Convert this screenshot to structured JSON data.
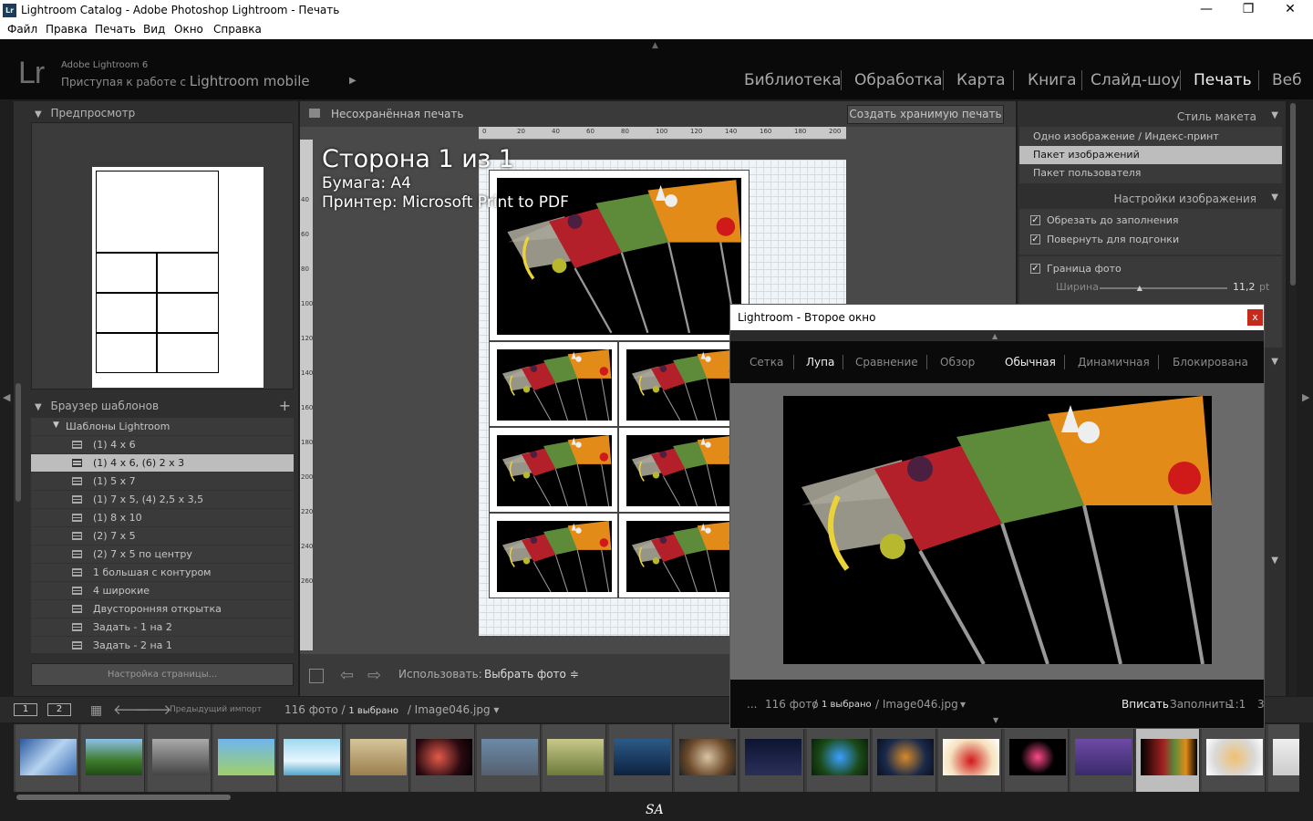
{
  "window": {
    "title": "Lightroom Catalog - Adobe Photoshop Lightroom - Печать",
    "app_badge": "Lr",
    "minimize": "—",
    "maximize": "❐",
    "close": "✕"
  },
  "menu": [
    "Файл",
    "Правка",
    "Печать",
    "Вид",
    "Окно",
    "Справка"
  ],
  "identity": {
    "logo": "Lr",
    "product": "Adobe Lightroom 6",
    "tagline_prefix": "Приступая к работе с",
    "tagline_brand": "Lightroom mobile",
    "play_icon": "▶"
  },
  "modules": [
    "Библиотека",
    "Обработка",
    "Карта",
    "Книга",
    "Слайд-шоу",
    "Печать",
    "Веб"
  ],
  "active_module": "Печать",
  "left_panel": {
    "preview_title": "Предпросмотр",
    "template_browser_title": "Браузер шаблонов",
    "add_icon": "+",
    "folder": "Шаблоны Lightroom",
    "templates": [
      "(1) 4 x 6",
      "(1) 4 x 6, (6) 2 x 3",
      "(1) 5 x 7",
      "(1) 7 x 5, (4) 2,5 x 3,5",
      "(1) 8 x 10",
      "(2) 7 x 5",
      "(2) 7 x 5 по центру",
      "1 большая с контуром",
      "4 широкие",
      "Двусторонняя открытка",
      "Задать - 1 на 2",
      "Задать - 2 на 1"
    ],
    "selected_template_index": 1,
    "page_setup_button": "Настройка страницы..."
  },
  "center": {
    "header_title": "Несохранённая печать",
    "create_button": "Создать хранимую печать",
    "ruler_top": [
      "0",
      "20",
      "40",
      "60",
      "80",
      "100",
      "120",
      "140",
      "160",
      "180",
      "200"
    ],
    "ruler_left": [
      "40",
      "60",
      "80",
      "100",
      "120",
      "140",
      "160",
      "180",
      "200",
      "220",
      "240",
      "260"
    ],
    "overlay_page": "Сторона 1 из 1",
    "overlay_paper": "Бумага:  A4",
    "overlay_printer": "Принтер:  Microsoft Print to PDF",
    "toolbar_use_label": "Использовать:",
    "toolbar_use_value": "Выбрать фото ≑",
    "prev_arrow": "⇦",
    "next_arrow": "⇨"
  },
  "right_panel": {
    "layout_style_title": "Стиль макета",
    "layout_styles": [
      "Одно изображение / Индекс-принт",
      "Пакет изображений",
      "Пакет пользователя"
    ],
    "selected_layout_style_index": 1,
    "image_settings_title": "Настройки изображения",
    "crop_to_fill": "Обрезать до заполнения",
    "rotate_to_fit": "Повернуть для подгонки",
    "photo_border": "Граница фото",
    "width_label": "Ширина",
    "width_value": "11,2",
    "width_unit": "pt",
    "width_fraction": 0.32,
    "collapse_icon": "▼",
    "check_mark": "✓"
  },
  "filmstrip_bar": {
    "screen1": "1",
    "screen2": "2",
    "grid_icon": "▦",
    "back_icon": "🡐",
    "forward_icon": "🡒",
    "source": "Предыдущий импорт",
    "count": "116 фото",
    "slash": "/",
    "selected": "1 выбрано",
    "filename": "/ Image046.jpg",
    "dropdown": "▾"
  },
  "filmstrip": {
    "thumbnails": [
      "sky",
      "mountains",
      "grayscale-city",
      "balloons",
      "clouds",
      "zebras",
      "space",
      "ruins",
      "castle",
      "dragon",
      "coffee",
      "music",
      "butterfly",
      "ornament",
      "apple",
      "fireworks",
      "flowers",
      "martini-glasses",
      "food",
      "white"
    ],
    "selected_index": 17
  },
  "watermark": "SA",
  "second_window": {
    "title": "Lightroom - Второе окно",
    "close": "x",
    "tabs": [
      "Сетка",
      "Лупа",
      "Сравнение",
      "Обзор"
    ],
    "active_tab": "Лупа",
    "modes": [
      "Обычная",
      "Динамичная",
      "Блокирована"
    ],
    "active_mode": "Обычная",
    "bottom": {
      "ellipsis": "...",
      "count": "116 фото",
      "slash": "/",
      "selected": "1 выбрано",
      "filename": "/ Image046.jpg",
      "dropdown": "▾",
      "fit": "Вписать",
      "fill": "Заполнить",
      "ratio": "1:1",
      "more": "3"
    }
  }
}
